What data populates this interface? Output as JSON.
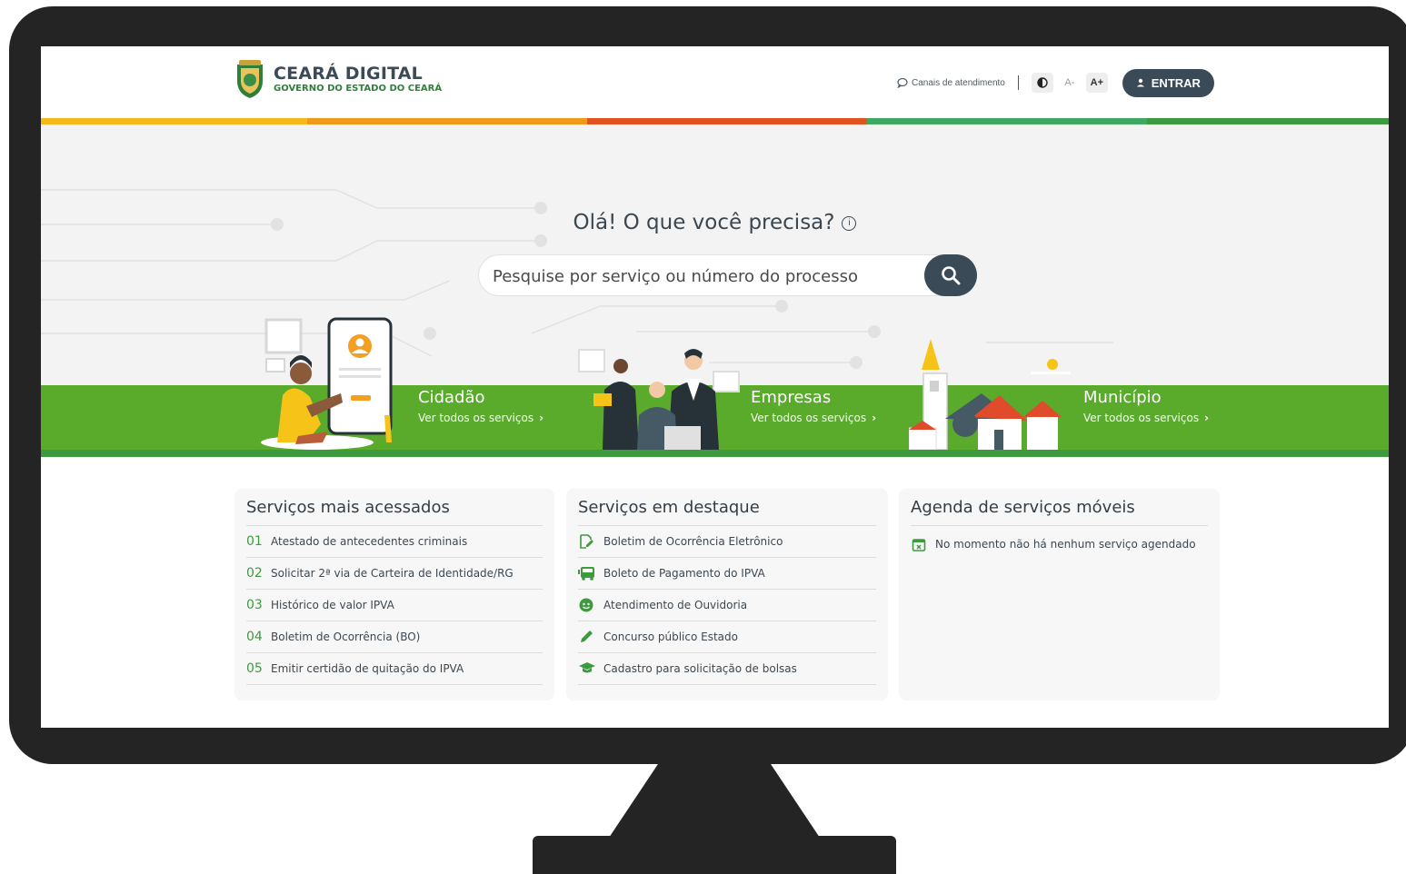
{
  "header": {
    "logo_title": "CEARÁ DIGITAL",
    "logo_subtitle": "GOVERNO DO ESTADO DO CEARÁ",
    "canais_label": "Canais de atendimento",
    "font_decrease": "A-",
    "font_increase": "A+",
    "login_label": "ENTRAR"
  },
  "colors": {
    "primary_dark": "#3a4a57",
    "green": "#5aab2c",
    "green_dark": "#3e9a3f",
    "bar": [
      "#f5b919",
      "#ef9a1b",
      "#e2541f",
      "#3fa964",
      "#3e9a3f"
    ]
  },
  "hero": {
    "title": "Olá! O que você precisa?",
    "info_icon": "i",
    "search_placeholder": "Pesquise por serviço ou número do processo"
  },
  "categories": [
    {
      "title": "Cidadão",
      "link": "Ver todos os serviços"
    },
    {
      "title": "Empresas",
      "link": "Ver todos os serviços"
    },
    {
      "title": "Município",
      "link": "Ver todos os serviços"
    }
  ],
  "most_accessed": {
    "title": "Serviços mais acessados",
    "items": [
      {
        "num": "01",
        "label": "Atestado de antecedentes criminais"
      },
      {
        "num": "02",
        "label": "Solicitar 2ª via de Carteira de Identidade/RG"
      },
      {
        "num": "03",
        "label": "Histórico de valor IPVA"
      },
      {
        "num": "04",
        "label": "Boletim de Ocorrência (BO)"
      },
      {
        "num": "05",
        "label": "Emitir certidão de quitação do IPVA"
      }
    ]
  },
  "featured": {
    "title": "Serviços em destaque",
    "items": [
      {
        "icon": "edit-document-icon",
        "label": "Boletim de Ocorrência Eletrônico"
      },
      {
        "icon": "bus-icon",
        "label": "Boleto de Pagamento do IPVA"
      },
      {
        "icon": "chat-face-icon",
        "label": "Atendimento de Ouvidoria"
      },
      {
        "icon": "pencil-icon",
        "label": "Concurso público Estado"
      },
      {
        "icon": "graduation-cap-icon",
        "label": "Cadastro para solicitação de bolsas"
      }
    ]
  },
  "agenda": {
    "title": "Agenda de serviços móveis",
    "empty_message": "No momento não há nenhum serviço agendado"
  }
}
